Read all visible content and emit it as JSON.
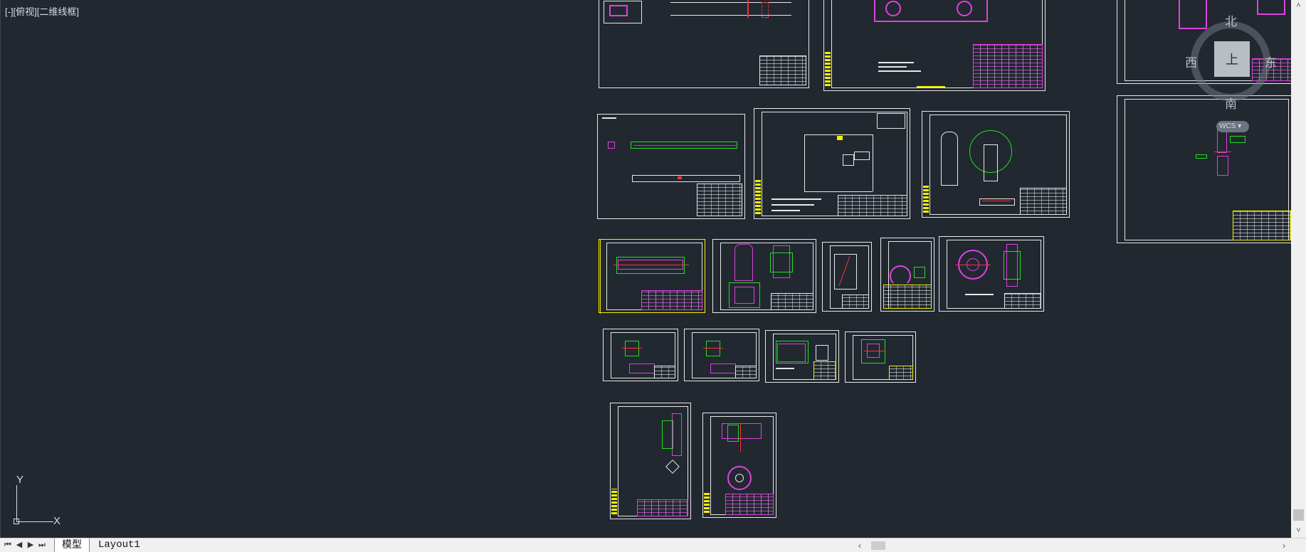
{
  "viewport": {
    "label": "[-][俯视][二维线框]",
    "background": "#212830"
  },
  "ucs": {
    "y_label": "Y",
    "x_label": "X"
  },
  "viewcube": {
    "north": "北",
    "south": "南",
    "west": "西",
    "east": "东",
    "face": "上",
    "wcs_label": "WCS"
  },
  "tabs": {
    "model": "模型",
    "layout1": "Layout1"
  },
  "icons": {
    "nav_first": "first-tab-icon",
    "nav_prev": "prev-tab-icon",
    "nav_next": "next-tab-icon",
    "nav_last": "last-tab-icon"
  },
  "scroll_glyphs": {
    "left": "‹",
    "right": "›",
    "up": "˄",
    "down": "˅",
    "first": "⏮",
    "prev": "◀",
    "next": "▶",
    "last": "⏭"
  },
  "colors": {
    "drawing_white": "#e8e8e8",
    "drawing_green": "#22dd22",
    "drawing_magenta": "#e040e0",
    "drawing_red": "#ff3030",
    "drawing_yellow": "#f3f000"
  }
}
